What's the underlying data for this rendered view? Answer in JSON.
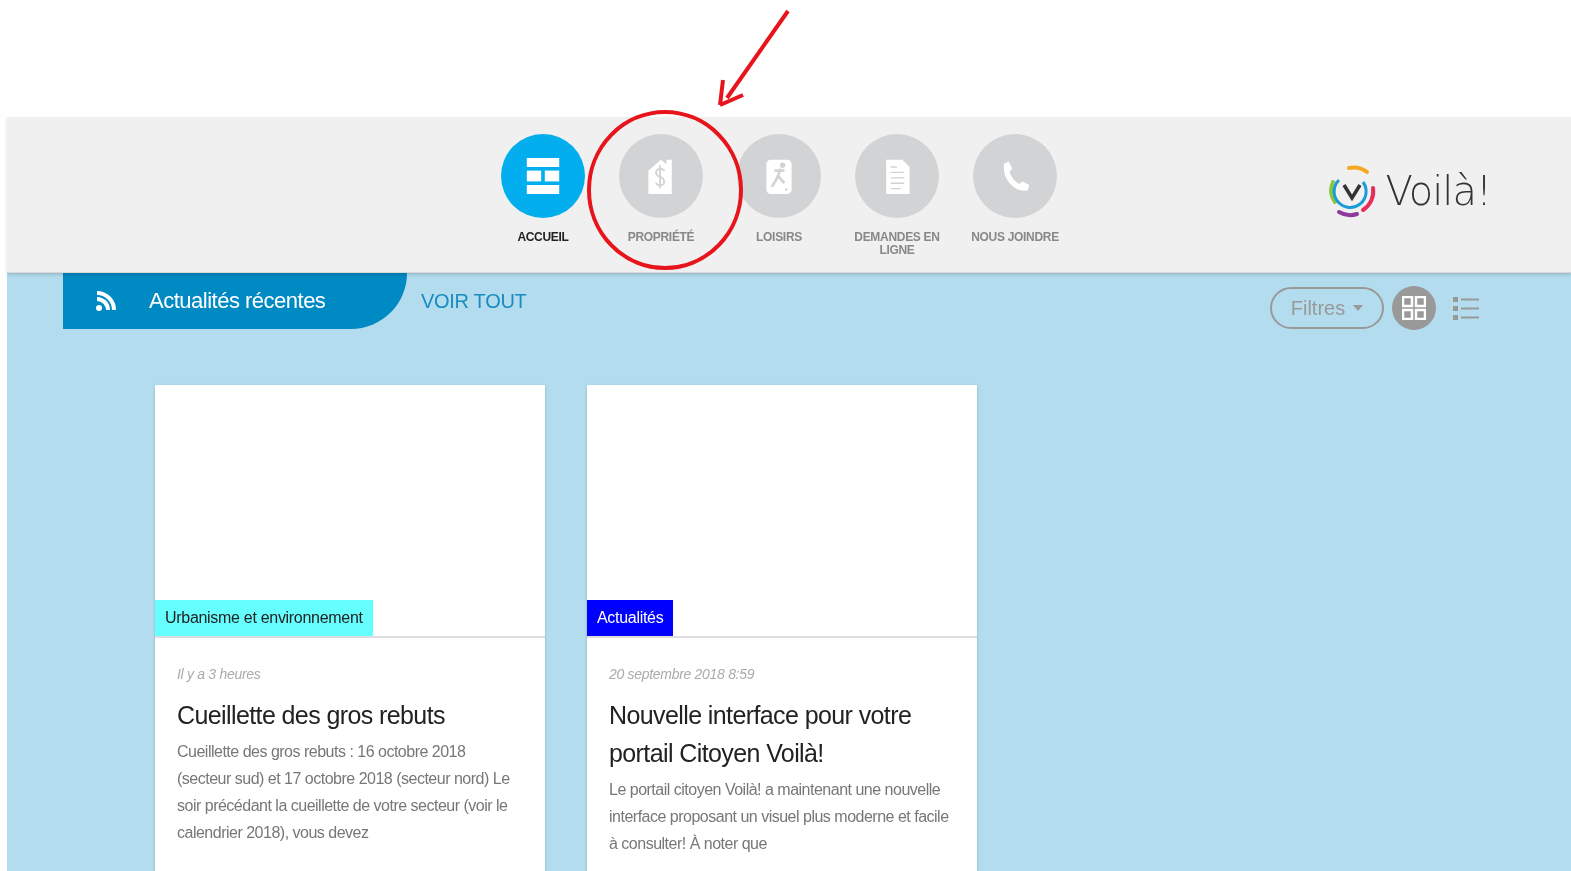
{
  "nav": [
    {
      "label": "ACCUEIL",
      "kind": "home",
      "selected": true
    },
    {
      "label": "PROPRIÉTÉ",
      "kind": "property",
      "selected": false
    },
    {
      "label": "LOISIRS",
      "kind": "leisure",
      "selected": false
    },
    {
      "label": "DEMANDES EN LIGNE",
      "kind": "document",
      "selected": false
    },
    {
      "label": "NOUS JOINDRE",
      "kind": "phone",
      "selected": false
    }
  ],
  "logo": {
    "text": "Voilà!"
  },
  "section": {
    "title": "Actualités récentes",
    "link": "VOIR TOUT"
  },
  "toolbar": {
    "filter": "Filtres",
    "views": [
      {
        "kind": "grid",
        "selected": true
      },
      {
        "kind": "list",
        "selected": false
      }
    ]
  },
  "cards": [
    {
      "tag": "Urbanisme et environnement",
      "color": "#66ffff",
      "date": "Il y a 3 heures",
      "title": "Cueillette des gros rebuts",
      "body": "Cueillette des gros rebuts :  16 octobre 2018 (secteur sud) et 17 octobre 2018 (secteur nord) Le soir précédant la cueillette de votre secteur (voir le calendrier 2018), vous devez"
    },
    {
      "tag": "Actualités",
      "color": "#0000ff",
      "date": "20 septembre 2018 8:59",
      "title": "Nouvelle interface pour votre portail Citoyen Voilà!",
      "body": "Le portail citoyen Voilà! a maintenant une nouvelle interface proposant un visuel plus moderne et facile à consulter! À noter que"
    }
  ]
}
